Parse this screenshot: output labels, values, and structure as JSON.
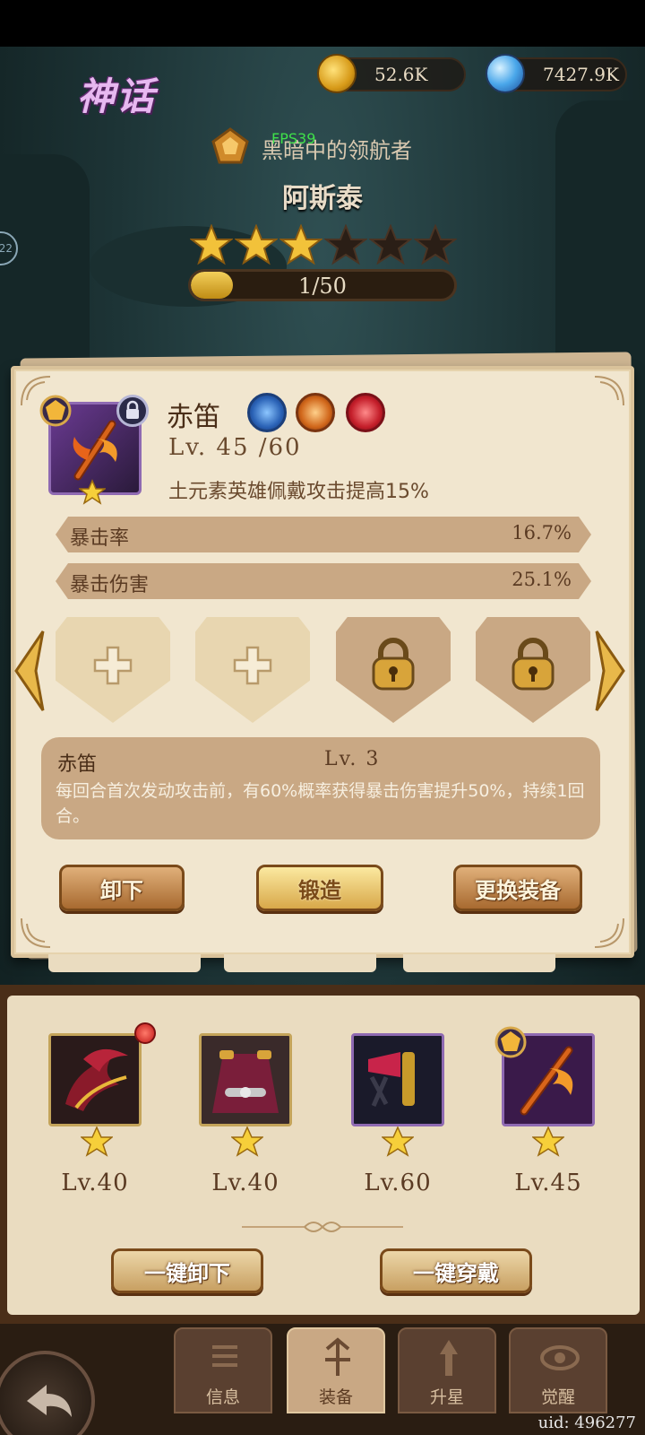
{
  "header": {
    "rarity_label": "神话",
    "gold_amount": "52.6K",
    "orb_amount": "7427.9K",
    "hero_title": "黑暗中的领航者",
    "fps_overlay": "FPS39",
    "hero_name": "阿斯泰",
    "star_rating": 3,
    "star_max": 6,
    "exp_text": "1/50",
    "exp_progress": 0.02,
    "side_counter": "22"
  },
  "item": {
    "name": "赤笛",
    "level": "Lv. 45 /60",
    "bonus": "土元素英雄佩戴攻击提高15%",
    "element_gems": [
      "blue-gem-icon",
      "orange-gem-icon",
      "red-gem-icon"
    ],
    "stats": [
      {
        "label": "暴击率",
        "value": "16.7%"
      },
      {
        "label": "暴击伤害",
        "value": "25.1%"
      }
    ],
    "slots": [
      "add",
      "add",
      "locked",
      "locked"
    ]
  },
  "skill": {
    "name": "赤笛",
    "level": "Lv. 3",
    "description": "每回合首次发动攻击前，有60%概率获得暴击伤害提升50%，持续1回合。"
  },
  "buttons": {
    "unequip": "卸下",
    "forge": "锻造",
    "replace": "更换装备",
    "unequip_all": "一键卸下",
    "equip_all": "一键穿戴"
  },
  "equipment": [
    {
      "level": "Lv.40",
      "icon": "helmet-icon",
      "has_alert": true
    },
    {
      "level": "Lv.40",
      "icon": "armor-icon",
      "has_alert": false
    },
    {
      "level": "Lv.60",
      "icon": "accessory-icon",
      "has_alert": false
    },
    {
      "level": "Lv.45",
      "icon": "flute-icon",
      "has_alert": false
    }
  ],
  "nav": {
    "tabs": [
      {
        "label": "信息",
        "icon": "info-icon"
      },
      {
        "label": "装备",
        "icon": "equipment-icon",
        "active": true
      },
      {
        "label": "升星",
        "icon": "upgrade-icon"
      },
      {
        "label": "觉醒",
        "icon": "awaken-icon"
      }
    ]
  },
  "footer": {
    "uid": "uid: 496277"
  },
  "colors": {
    "parchment": "#f1e6cf",
    "stat_bar": "#c9a884",
    "gold": "#d8a84a",
    "rarity": "#e7b8f0"
  }
}
